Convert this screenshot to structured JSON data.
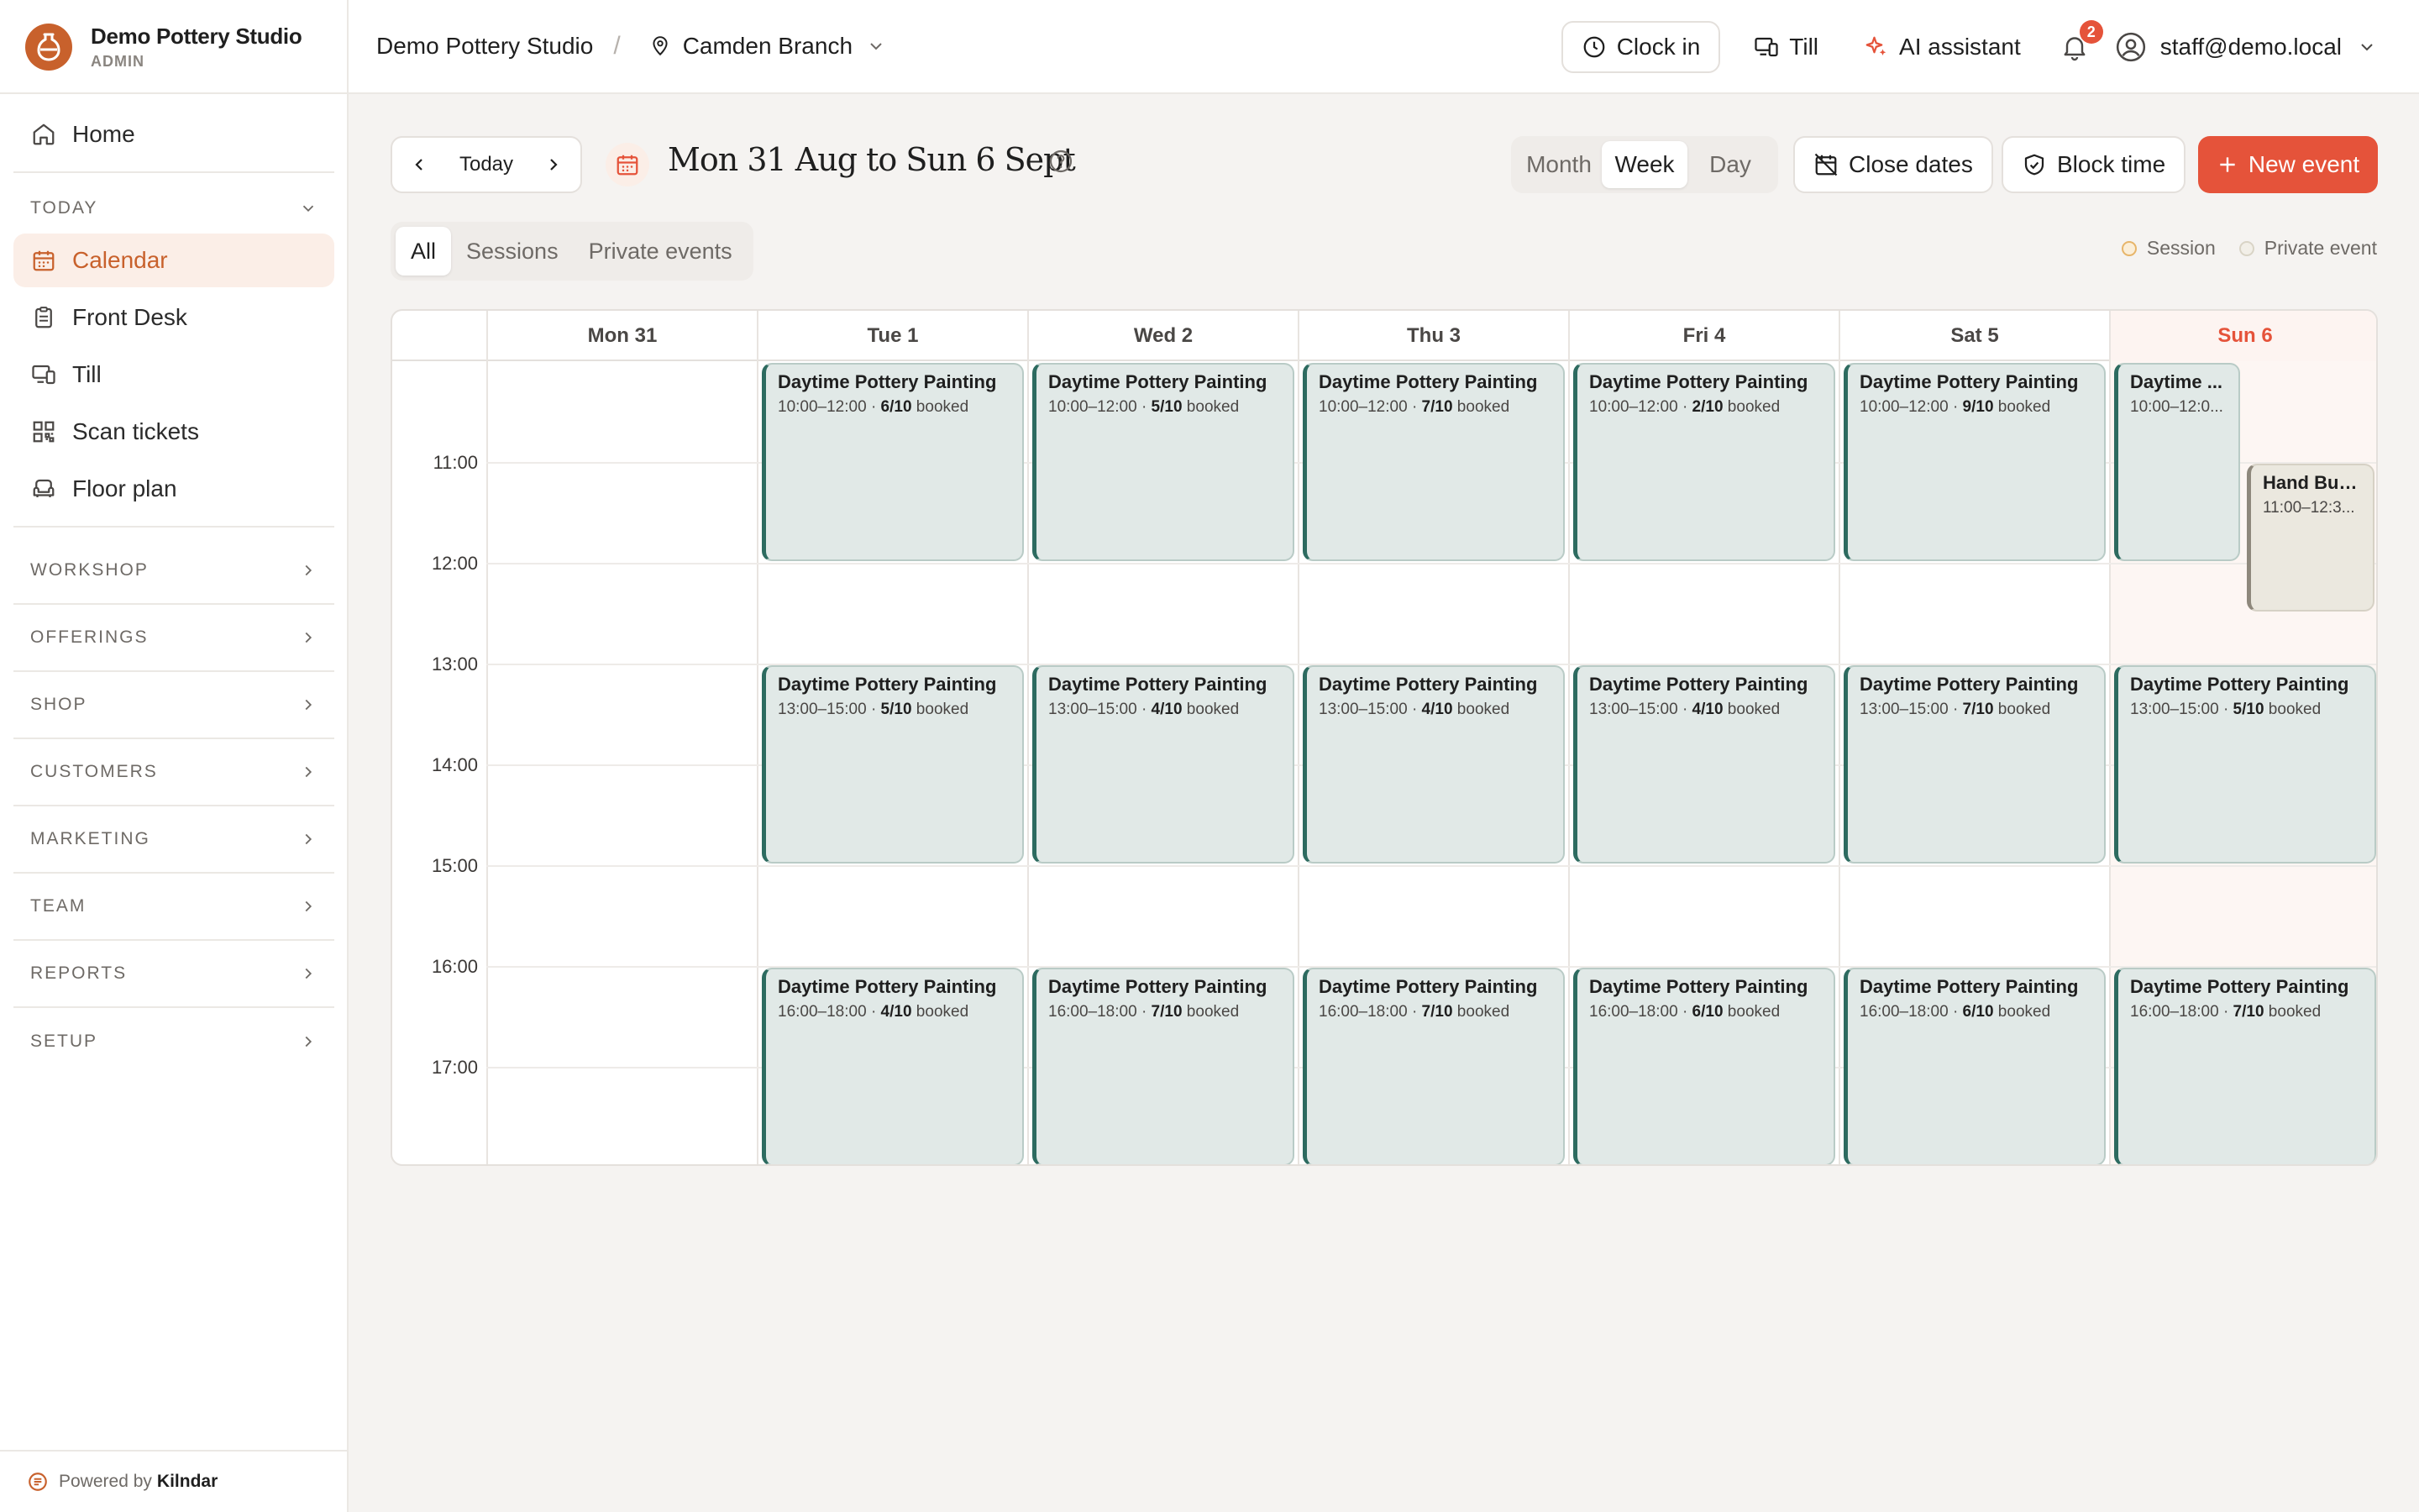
{
  "brand": {
    "name": "Demo Pottery Studio",
    "role": "ADMIN"
  },
  "sidebar": {
    "home": "Home",
    "today_section": "TODAY",
    "today_items": [
      "Calendar",
      "Front Desk",
      "Till",
      "Scan tickets",
      "Floor plan"
    ],
    "groups": [
      "WORKSHOP",
      "OFFERINGS",
      "SHOP",
      "CUSTOMERS",
      "MARKETING",
      "TEAM",
      "REPORTS",
      "SETUP"
    ],
    "powered_prefix": "Powered by",
    "powered_brand": "Kilndar"
  },
  "topbar": {
    "studio": "Demo Pottery Studio",
    "separator": "/",
    "branch": "Camden Branch",
    "clock_in": "Clock in",
    "till": "Till",
    "ai": "AI assistant",
    "notifications": "2",
    "user": "staff@demo.local"
  },
  "toolbar": {
    "today": "Today",
    "range": "Mon 31 Aug to Sun 6 Sept",
    "views": [
      "Month",
      "Week",
      "Day"
    ],
    "active_view": "Week",
    "close_dates": "Close dates",
    "block_time": "Block time",
    "new_event": "New event"
  },
  "filters": {
    "items": [
      "All",
      "Sessions",
      "Private events"
    ],
    "active": "All"
  },
  "legend": {
    "session": "Session",
    "private": "Private event",
    "session_color": "#e7b56a",
    "private_color": "#d9d4c6"
  },
  "calendar": {
    "days": [
      "Mon 31",
      "Tue 1",
      "Wed 2",
      "Thu 3",
      "Fri 4",
      "Sat 5",
      "Sun 6"
    ],
    "today_index": 6,
    "hours": [
      "11:00",
      "12:00",
      "13:00",
      "14:00",
      "15:00",
      "16:00",
      "17:00"
    ],
    "booked_word": "booked",
    "events": [
      {
        "day": 1,
        "start": 10,
        "end": 12,
        "title": "Daytime Pottery Painting",
        "time": "10:00–12:00 ·",
        "booked": "6/10"
      },
      {
        "day": 2,
        "start": 10,
        "end": 12,
        "title": "Daytime Pottery Painting",
        "time": "10:00–12:00 ·",
        "booked": "5/10"
      },
      {
        "day": 3,
        "start": 10,
        "end": 12,
        "title": "Daytime Pottery Painting",
        "time": "10:00–12:00 ·",
        "booked": "7/10"
      },
      {
        "day": 4,
        "start": 10,
        "end": 12,
        "title": "Daytime Pottery Painting",
        "time": "10:00–12:00 ·",
        "booked": "2/10"
      },
      {
        "day": 5,
        "start": 10,
        "end": 12,
        "title": "Daytime Pottery Painting",
        "time": "10:00–12:00 ·",
        "booked": "9/10"
      },
      {
        "day": 6,
        "start": 10,
        "end": 12,
        "title": "Daytime ...",
        "time": "10:00–12:0...",
        "booked": "",
        "narrow": "left"
      },
      {
        "day": 6,
        "start": 11,
        "end": 12.5,
        "title": "Hand Buil...",
        "time": "11:00–12:3...",
        "booked": "",
        "narrow": "right",
        "private": true
      },
      {
        "day": 1,
        "start": 13,
        "end": 15,
        "title": "Daytime Pottery Painting",
        "time": "13:00–15:00 ·",
        "booked": "5/10"
      },
      {
        "day": 2,
        "start": 13,
        "end": 15,
        "title": "Daytime Pottery Painting",
        "time": "13:00–15:00 ·",
        "booked": "4/10"
      },
      {
        "day": 3,
        "start": 13,
        "end": 15,
        "title": "Daytime Pottery Painting",
        "time": "13:00–15:00 ·",
        "booked": "4/10"
      },
      {
        "day": 4,
        "start": 13,
        "end": 15,
        "title": "Daytime Pottery Painting",
        "time": "13:00–15:00 ·",
        "booked": "4/10"
      },
      {
        "day": 5,
        "start": 13,
        "end": 15,
        "title": "Daytime Pottery Painting",
        "time": "13:00–15:00 ·",
        "booked": "7/10"
      },
      {
        "day": 6,
        "start": 13,
        "end": 15,
        "title": "Daytime Pottery Painting",
        "time": "13:00–15:00 ·",
        "booked": "5/10"
      },
      {
        "day": 1,
        "start": 16,
        "end": 18,
        "title": "Daytime Pottery Painting",
        "time": "16:00–18:00 ·",
        "booked": "4/10"
      },
      {
        "day": 2,
        "start": 16,
        "end": 18,
        "title": "Daytime Pottery Painting",
        "time": "16:00–18:00 ·",
        "booked": "7/10"
      },
      {
        "day": 3,
        "start": 16,
        "end": 18,
        "title": "Daytime Pottery Painting",
        "time": "16:00–18:00 ·",
        "booked": "7/10"
      },
      {
        "day": 4,
        "start": 16,
        "end": 18,
        "title": "Daytime Pottery Painting",
        "time": "16:00–18:00 ·",
        "booked": "6/10"
      },
      {
        "day": 5,
        "start": 16,
        "end": 18,
        "title": "Daytime Pottery Painting",
        "time": "16:00–18:00 ·",
        "booked": "6/10"
      },
      {
        "day": 6,
        "start": 16,
        "end": 18,
        "title": "Daytime Pottery Painting",
        "time": "16:00–18:00 ·",
        "booked": "7/10"
      }
    ]
  },
  "colors": {
    "accent": "#c8612c",
    "primary_button": "#e5533a",
    "session_border": "#2d6b60"
  }
}
